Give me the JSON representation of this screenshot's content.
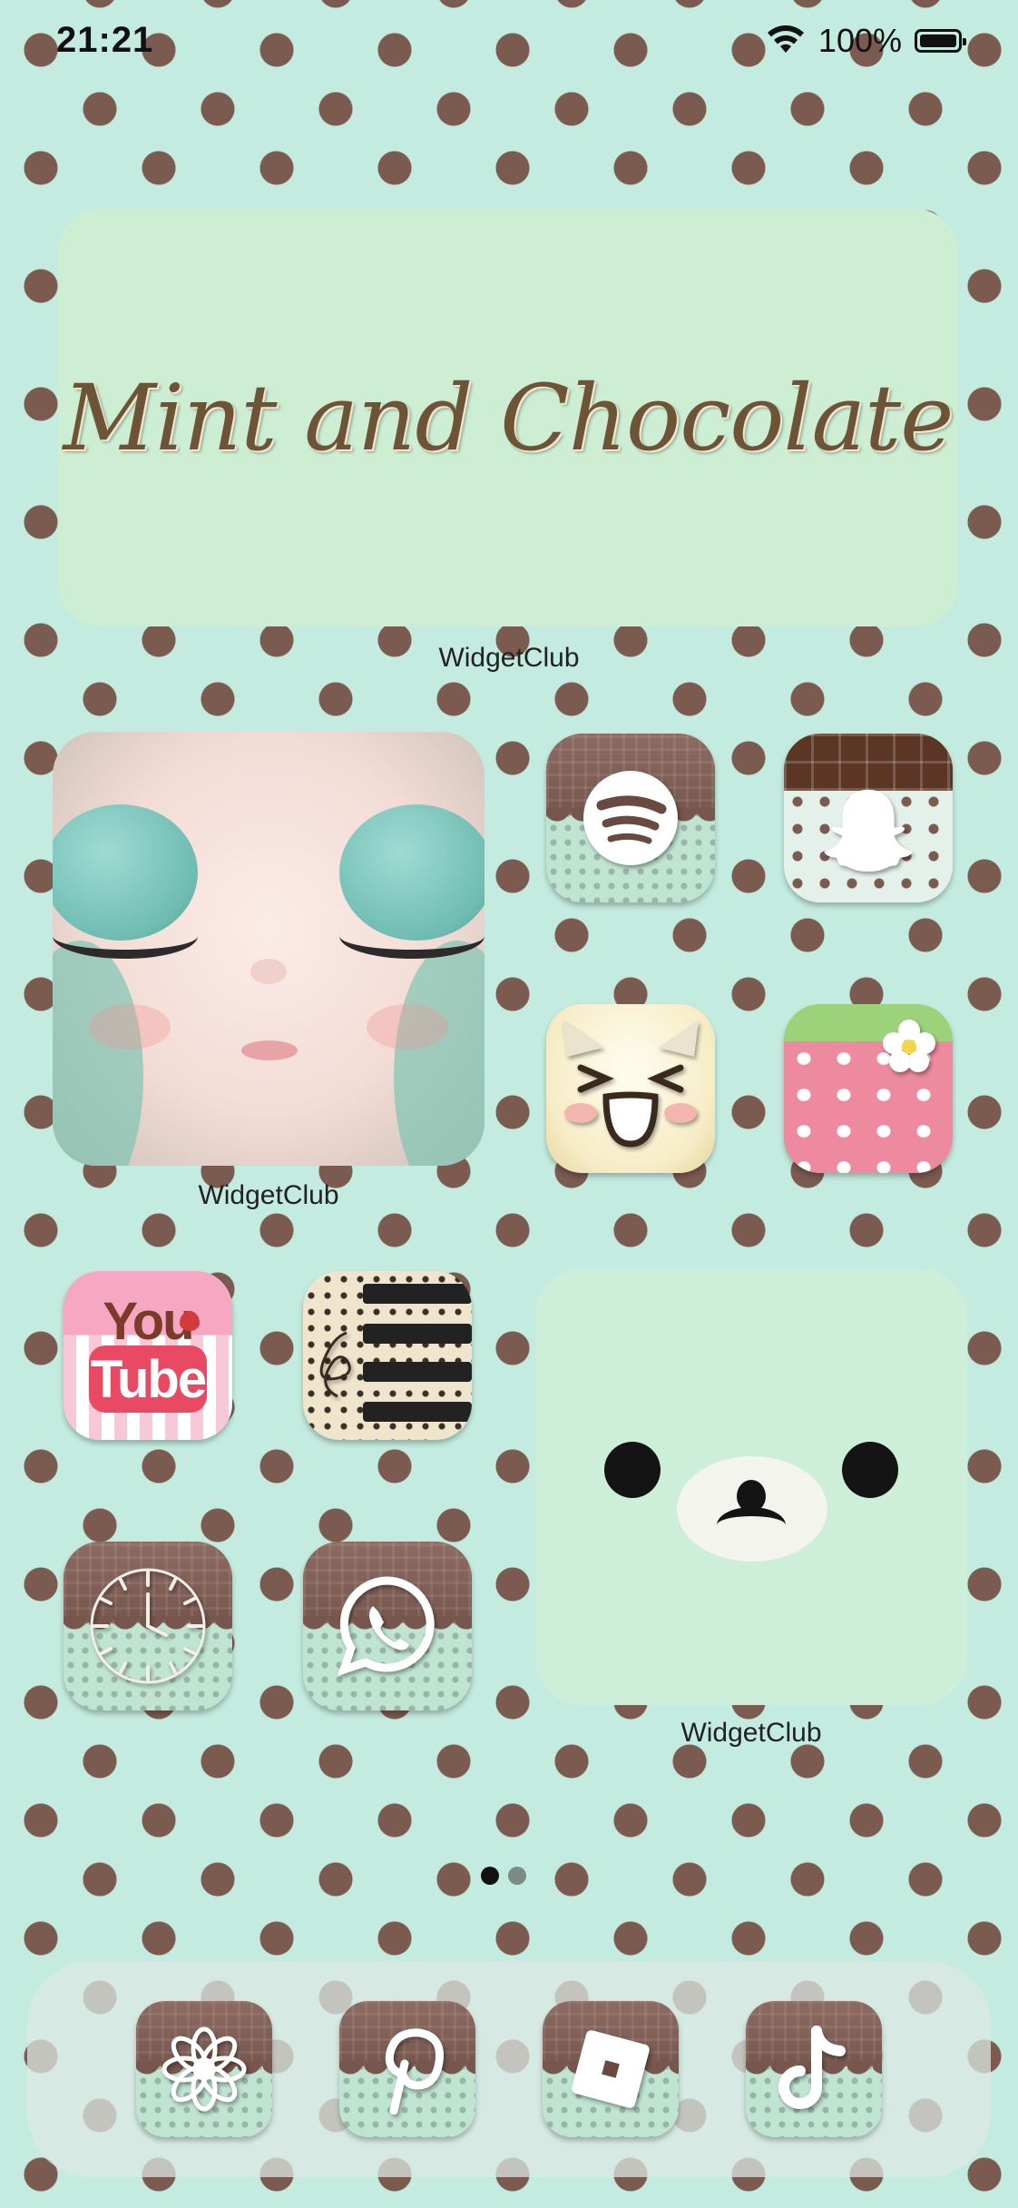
{
  "status_bar": {
    "time": "21:21",
    "battery_percent": "100%"
  },
  "widgets": {
    "banner": {
      "text": "Mint and Chocolate",
      "caption": "WidgetClub"
    },
    "photo": {
      "caption": "WidgetClub"
    },
    "bear": {
      "caption": "WidgetClub"
    }
  },
  "apps": {
    "youtube": {
      "line1": "You",
      "line2": "Tube"
    }
  },
  "pagination": {
    "pages": 2,
    "current": 1
  },
  "colors": {
    "mint": "#c4ebdf",
    "chocolate": "#7b5a50",
    "dot": "#7b5a50"
  },
  "icons": [
    "spotify-icon",
    "snapchat-icon",
    "cat-face-icon",
    "strawberry-icon",
    "youtube-icon",
    "piano-icon",
    "clock-icon",
    "whatsapp-icon",
    "flower-icon",
    "pinterest-icon",
    "roblox-icon",
    "tiktok-icon"
  ]
}
